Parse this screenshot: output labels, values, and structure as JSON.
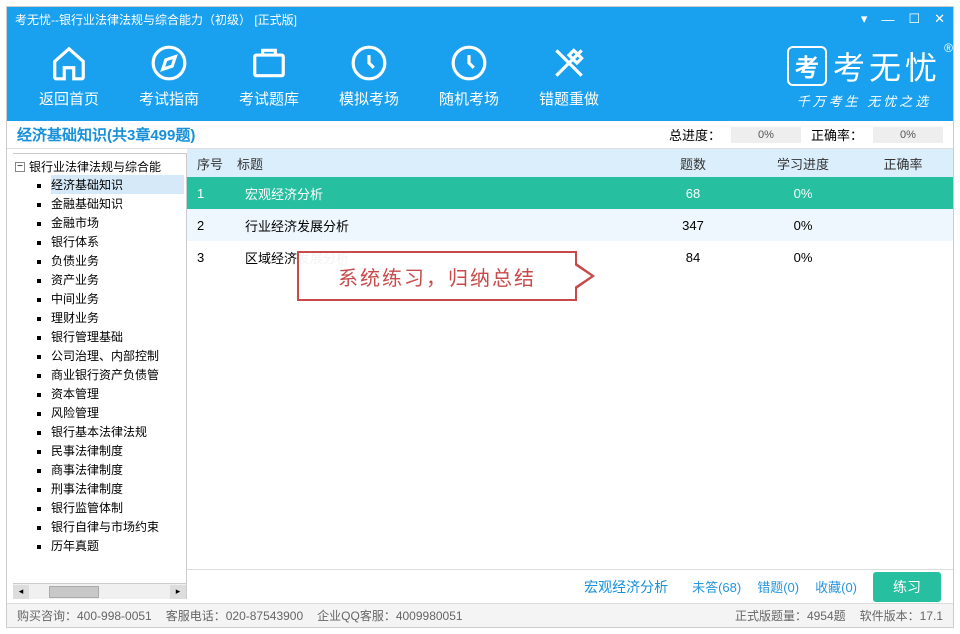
{
  "titlebar": {
    "title": "考无忧--银行业法律法规与综合能力（初级） [正式版]"
  },
  "nav": {
    "items": [
      {
        "label": "返回首页",
        "icon": "home"
      },
      {
        "label": "考试指南",
        "icon": "compass"
      },
      {
        "label": "考试题库",
        "icon": "briefcase"
      },
      {
        "label": "模拟考场",
        "icon": "clock"
      },
      {
        "label": "随机考场",
        "icon": "clock"
      },
      {
        "label": "错题重做",
        "icon": "edit"
      }
    ],
    "brand": {
      "badge": "考",
      "name": "考无忧",
      "slogan": "千万考生 无忧之选"
    }
  },
  "summary": {
    "title": "经济基础知识(共3章499题)",
    "progress_label": "总进度：",
    "progress_value": "0%",
    "accuracy_label": "正确率：",
    "accuracy_value": "0%"
  },
  "tree": {
    "root": "银行业法律法规与综合能",
    "children": [
      "经济基础知识",
      "金融基础知识",
      "金融市场",
      "银行体系",
      "负债业务",
      "资产业务",
      "中间业务",
      "理财业务",
      "银行管理基础",
      "公司治理、内部控制",
      "商业银行资产负债管",
      "资本管理",
      "风险管理",
      "银行基本法律法规",
      "民事法律制度",
      "商事法律制度",
      "刑事法律制度",
      "银行监管体制",
      "银行自律与市场约束",
      "历年真题"
    ]
  },
  "table": {
    "headers": {
      "idx": "序号",
      "title": "标题",
      "count": "题数",
      "progress": "学习进度",
      "accuracy": "正确率"
    },
    "rows": [
      {
        "idx": "1",
        "title": "宏观经济分析",
        "count": "68",
        "progress": "0%",
        "accuracy": ""
      },
      {
        "idx": "2",
        "title": "行业经济发展分析",
        "count": "347",
        "progress": "0%",
        "accuracy": ""
      },
      {
        "idx": "3",
        "title": "区域经济发展分析",
        "count": "84",
        "progress": "0%",
        "accuracy": ""
      }
    ]
  },
  "callout": {
    "text": "系统练习，归纳总结"
  },
  "bottom": {
    "current": "宏观经济分析",
    "unanswered": "未答(68)",
    "wrong": "错题(0)",
    "fav": "收藏(0)",
    "practice": "练习"
  },
  "status": {
    "buy": "购买咨询：400-998-0051",
    "service": "客服电话：020-87543900",
    "qq": "企业QQ客服：4009980051",
    "qty": "正式版题量：4954题",
    "ver": "软件版本：17.1"
  }
}
